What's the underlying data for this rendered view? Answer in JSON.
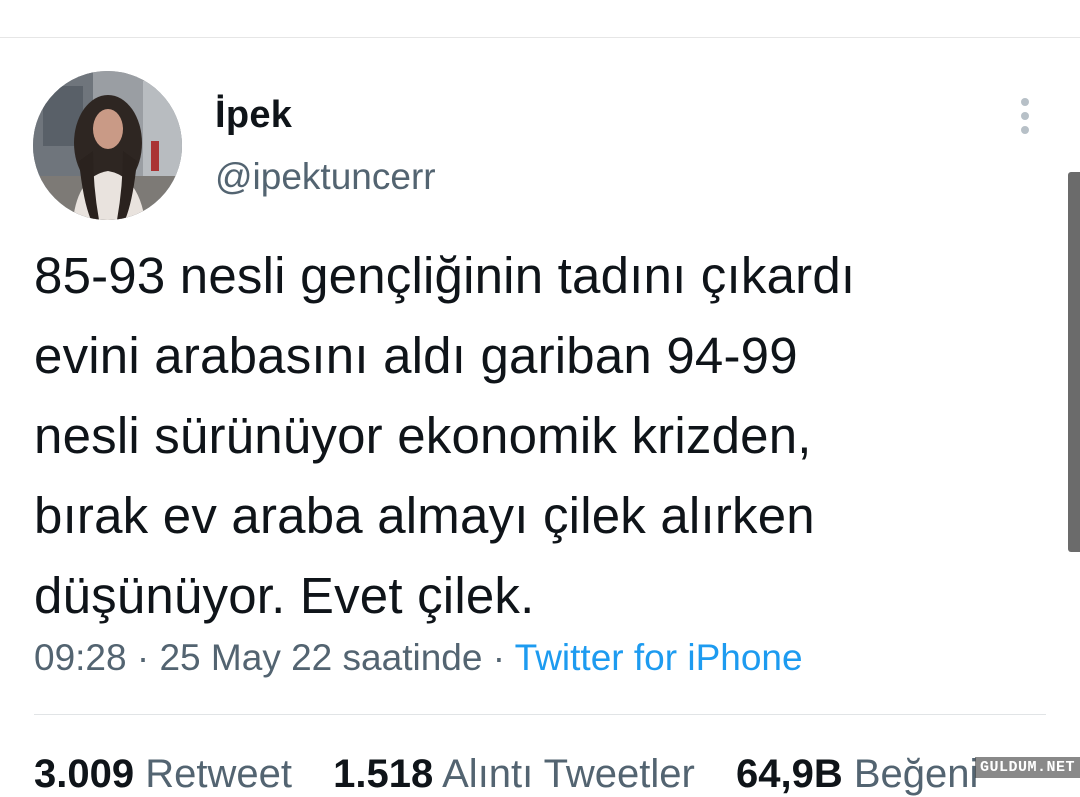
{
  "tweet": {
    "author_name": "İpek",
    "author_handle": "@ipektuncerr",
    "text_lines": [
      "85-93 nesli gençliğinin tadını çıkardı",
      "evini arabasını aldı gariban 94-99",
      "nesli sürünüyor ekonomik krizden,",
      "bırak ev araba almayı çilek alırken",
      "düşünüyor. Evet çilek."
    ],
    "time": "09:28",
    "separator": "·",
    "date_text": "25 May 22 saatinde",
    "source": "Twitter for iPhone"
  },
  "stats": {
    "retweets_count": "3.009",
    "retweets_label": "Retweet",
    "quotes_count": "1.518",
    "quotes_label": "Alıntı Tweetler",
    "likes_count": "64,9B",
    "likes_label": "Beğeni"
  },
  "watermark": "GULDUM.NET",
  "icons": {
    "more": "more-vertical-icon"
  },
  "colors": {
    "text": "#0f1419",
    "secondary": "#536471",
    "link": "#1d9bf0"
  }
}
